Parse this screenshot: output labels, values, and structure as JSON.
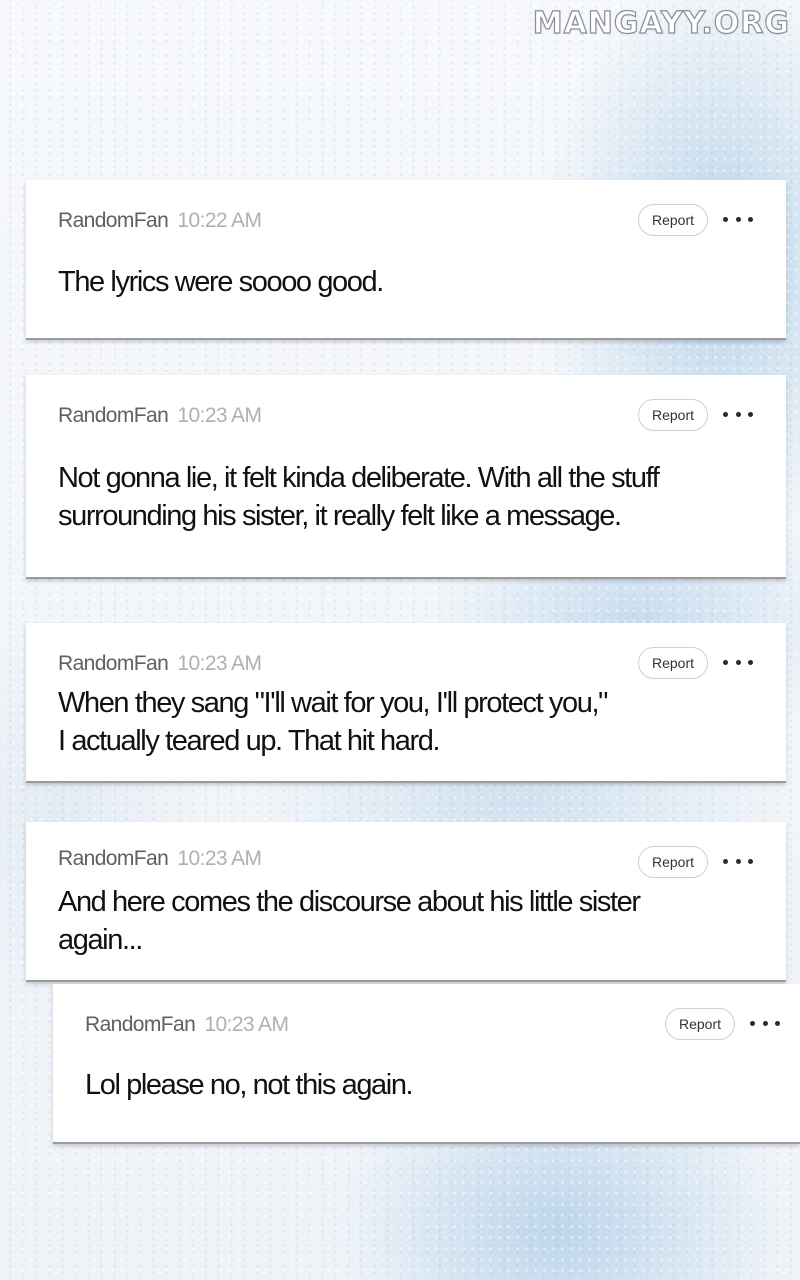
{
  "watermark": "MANGAYY.ORG",
  "comments": [
    {
      "username": "RandomFan",
      "time": "10:22 AM",
      "text": "The lyrics were soooo good.",
      "report_label": "Report"
    },
    {
      "username": "RandomFan",
      "time": "10:23 AM",
      "text_lines": [
        "Not gonna lie, it felt kinda deliberate. With all the stuff",
        "surrounding his sister, it really felt like a message."
      ],
      "report_label": "Report"
    },
    {
      "username": "RandomFan",
      "time": "10:23 AM",
      "text_lines": [
        "When they sang \"I'll wait for you, I'll protect you,\"",
        "I actually teared up. That hit hard."
      ],
      "report_label": "Report"
    },
    {
      "username": "RandomFan",
      "time": "10:23 AM",
      "text_lines": [
        "And here comes the discourse about his little sister",
        "again..."
      ],
      "report_label": "Report"
    },
    {
      "username": "RandomFan",
      "time": "10:23 AM",
      "text": "Lol please no, not this again.",
      "report_label": "Report",
      "is_reply": true
    }
  ],
  "icons": {
    "more": "more-options-icon"
  }
}
